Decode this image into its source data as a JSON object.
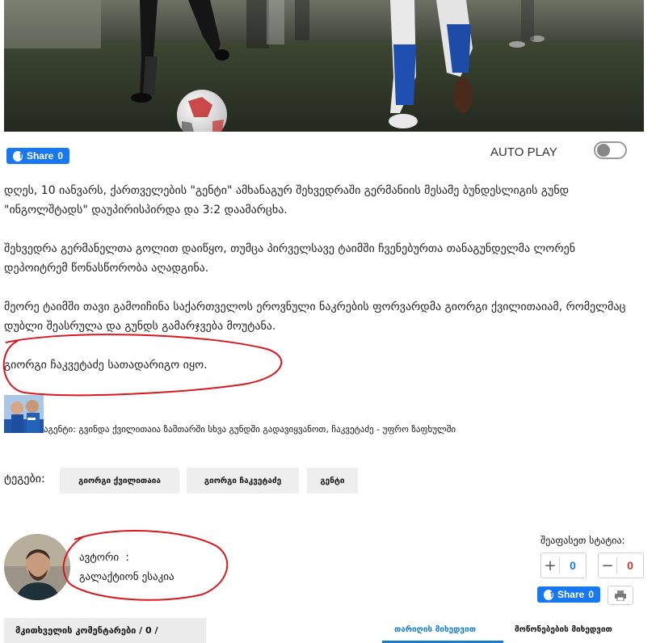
{
  "share": {
    "label": "Share",
    "count": "0"
  },
  "autoplay": {
    "label": "AUTO PLAY",
    "enabled": false
  },
  "article": {
    "paragraphs": [
      "დღეს, 10 იანვარს, ქართველების \"გენტი\" ამხანაგურ შეხვედრაში გერმანიის მესამე ბუნდესლიგის გუნდ \"ინგოლშტადს\" დაუპირისპირდა და 3:2 დაამარცხა.",
      "შეხვედრა გერმანელთა გოლით დაიწყო, თუმცა პირველსავე ტაიმში ჩვენებურთა თანაგუნდელმა ლორენ დეპოიტრემ წონასწორობა აღადგინა.",
      "მეორე ტაიმში თავი გამოიჩინა საქართველოს ეროვნული ნაკრების ფორვარდმა გიორგი ქვილითაიამ, რომელმაც დუბლი შეასრულა და გუნდს გამარჯვება მოუტანა.",
      "გიორგი ჩაკვეტაძე სათადარიგო იყო."
    ]
  },
  "related": {
    "text": "აგენტი: გვინდა ქვილითაია ზამთარში სხვა გუნდში გადავიყვანოთ, ჩაკვეტაძე - უფრო ზაფხულში"
  },
  "tags": {
    "label": "ტეგები:",
    "items": [
      "გიორგი ქვილითაია",
      "გიორგი ჩაკვეტაძე",
      "გენტი"
    ]
  },
  "author": {
    "label": "ავტორი",
    "separator": ":",
    "name": "გალაქტიონ ესაკია"
  },
  "rating": {
    "label": "შეაფასეთ სტატია:",
    "plus_count": "0",
    "minus_count": "0",
    "plus_color": "#1a7dd4",
    "minus_color": "#d9342b"
  },
  "share_bottom": {
    "label": "Share",
    "count": "0"
  },
  "comments": {
    "header": "მკითხველის კომენტარები / 0 /",
    "sort_tabs": [
      "თარიღის მიხედვით",
      "მოწონებების მიხედვით"
    ],
    "active_tab": 0
  },
  "colors": {
    "facebook": "#1877f2",
    "accent": "#1a7dd4",
    "annotation": "#d7191f"
  }
}
